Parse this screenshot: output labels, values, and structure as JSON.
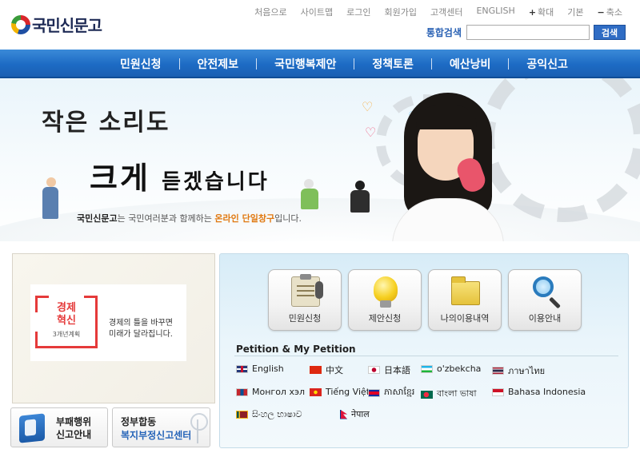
{
  "header": {
    "logo_text": "국민신문고",
    "util_links": [
      "처음으로",
      "사이트맵",
      "로그인",
      "회원가입",
      "고객센터",
      "ENGLISH"
    ],
    "zoom": {
      "plus_label": "확대",
      "default_label": "기본",
      "minus_label": "축소"
    },
    "search": {
      "label": "통합검색",
      "button": "검색",
      "value": ""
    }
  },
  "nav": {
    "items": [
      "민원신청",
      "안전제보",
      "국민행복제안",
      "정책토론",
      "예산낭비",
      "공익신고"
    ]
  },
  "hero": {
    "line1": "작은 소리도",
    "line2_big": "크게",
    "line2_rest": "듣겠습니다",
    "desc_brand": "국민신문고",
    "desc_mid": "는 국민여러분과 함께하는 ",
    "desc_accent": "온라인 단일창구",
    "desc_end": "입니다."
  },
  "promo": {
    "title_line1": "경제",
    "title_line2": "혁신",
    "subtitle": "3개년계획",
    "text_line1": "경제의 틀을 바꾸면",
    "text_line2": "미래가 달라집니다."
  },
  "bottom_buttons": {
    "anti": {
      "line1": "부패행위",
      "line2": "신고안내"
    },
    "welfare": {
      "line1": "정부합동",
      "line2": "복지부정신고센터"
    }
  },
  "services": [
    {
      "label": "민원신청",
      "icon": "clipboard-mic-icon"
    },
    {
      "label": "제안신청",
      "icon": "lightbulb-icon"
    },
    {
      "label": "나의이용내역",
      "icon": "folder-icon"
    },
    {
      "label": "이용안내",
      "icon": "magnifier-icon"
    }
  ],
  "petition": {
    "title": "Petition & My Petition",
    "languages": [
      {
        "label": "English",
        "flag": "uk-flag-icon"
      },
      {
        "label": "中文",
        "flag": "china-flag-icon"
      },
      {
        "label": "日本語",
        "flag": "japan-flag-icon"
      },
      {
        "label": "o'zbekcha",
        "flag": "uzbekistan-flag-icon"
      },
      {
        "label": "ภาษาไทย",
        "flag": "thailand-flag-icon"
      },
      {
        "label": "Монгол хэл",
        "flag": "mongolia-flag-icon"
      },
      {
        "label": "Tiếng Việt",
        "flag": "vietnam-flag-icon"
      },
      {
        "label": "ភាសាខ្មែរ",
        "flag": "cambodia-flag-icon"
      },
      {
        "label": "বাংলা ভাষা",
        "flag": "bangladesh-flag-icon"
      },
      {
        "label": "Bahasa Indonesia",
        "flag": "indonesia-flag-icon"
      },
      {
        "label": "සිංහල භාෂාව",
        "flag": "sri-lanka-flag-icon"
      },
      {
        "label": "नेपाल",
        "flag": "nepal-flag-icon"
      }
    ]
  },
  "colors": {
    "nav_blue": "#1d6bc4",
    "search_label": "#2a62b4",
    "accent_orange": "#e07810",
    "promo_red": "#e53a3a"
  }
}
